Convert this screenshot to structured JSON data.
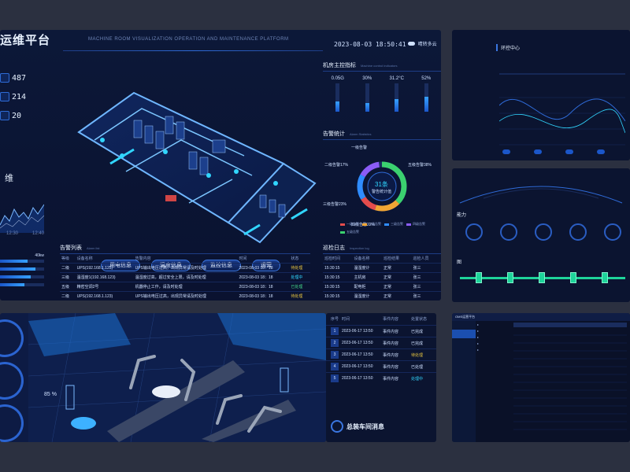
{
  "main": {
    "title": "运维平台",
    "subtitle": "MACHINE ROOM VISUALIZATION OPERATION AND MAINTENANCE PLATFORM",
    "datetime": "2023-08-03  18:50:41",
    "weather": "晴转多云",
    "left_stats": [
      {
        "value": "487",
        "icon": "server-icon"
      },
      {
        "value": "214",
        "icon": "cabinet-icon"
      },
      {
        "value": "20",
        "icon": "power-icon"
      }
    ],
    "left_ticks": [
      "12:30",
      "12:40"
    ],
    "dh_label": "维",
    "left_bars": [
      {
        "value": "40kw",
        "fill": 0.62
      },
      {
        "value": "",
        "fill": 0.8
      },
      {
        "value": "",
        "fill": 0.7
      },
      {
        "value": "",
        "fill": 0.55
      }
    ],
    "buttons": [
      "用电信息",
      "温度信息",
      "监控信息",
      "运营"
    ],
    "machine_indicators": {
      "title": "机房主控指标",
      "title_en": "Machine control indicators",
      "gauges": [
        {
          "value": "0.05G",
          "level": 0.35
        },
        {
          "value": "30%",
          "level": 0.3
        },
        {
          "value": "31.2°C",
          "level": 0.45
        },
        {
          "value": "52%",
          "level": 0.52
        }
      ]
    },
    "alarm_stats": {
      "title": "告警统计",
      "title_en": "Alarm Statistics",
      "center_value": "31条",
      "center_label": "警告统计值",
      "labels": [
        "一级告警",
        "二级告警17%",
        "三级告警23%",
        "四级告警22%",
        "五级告警38%"
      ],
      "legend": [
        {
          "label": "一级告警",
          "color": "#e44c4c"
        },
        {
          "label": "二级告警",
          "color": "#f0a534"
        },
        {
          "label": "三级告警",
          "color": "#2f8cff"
        },
        {
          "label": "四级告警",
          "color": "#8b5cf6"
        },
        {
          "label": "五级告警",
          "color": "#3bd16f"
        }
      ]
    },
    "alarm_list": {
      "title": "告警列表",
      "title_en": "Alarm list",
      "headers": [
        "等级",
        "设备名称",
        "告警内容",
        "时间",
        "状态"
      ],
      "rows": [
        [
          "二级",
          "UPS(192.168.1.123)",
          "UPS输出电压过高，出现异常请及时处理",
          "2023-08-03  18：18",
          "待处理"
        ],
        [
          "三级",
          "温湿度1(192.168.123)",
          "温湿度过高，超过安全上限，请及时处理",
          "2023-08-03  18：18",
          "处理中"
        ],
        [
          "五级",
          "精密空调2号",
          "机器停止工作，请及时处理",
          "2023-08-03  18：18",
          "已处理"
        ],
        [
          "二级",
          "UPS(192.168.1.123)",
          "UPS输出电压过高，出现异常请及时处理",
          "2023-08-03  18：18",
          "待处理"
        ]
      ]
    },
    "log": {
      "title": "巡检日志",
      "title_en": "Inspection log",
      "headers": [
        "巡检时间",
        "设备名称",
        "巡检结果",
        "巡检人员"
      ],
      "rows": [
        [
          "15:30:15",
          "温湿度计",
          "正常",
          "张三"
        ],
        [
          "15:30:15",
          "主机房",
          "正常",
          "张三"
        ],
        [
          "15:30:15",
          "配电柜",
          "正常",
          "张三"
        ],
        [
          "15:30:15",
          "温湿度计",
          "正常",
          "张三"
        ]
      ]
    }
  },
  "rtop": {
    "tab": "环控中心",
    "rows": [
      [
        "",
        "",
        "",
        "",
        "",
        ""
      ],
      [
        "",
        "",
        "",
        "",
        "",
        ""
      ]
    ]
  },
  "rmid": {
    "sections": [
      "能力",
      "图"
    ]
  },
  "bottom_left": {
    "pct": "85 %",
    "floor_title": ""
  },
  "events": {
    "headers": [
      "序号",
      "时间",
      "事件内容",
      "处置状态"
    ],
    "rows": [
      {
        "n": "1",
        "time": "2023-06-17 13:50",
        "event": "事件内容",
        "status": "已完成",
        "color": "#cfe0ff"
      },
      {
        "n": "2",
        "time": "2023-06-17 13:50",
        "event": "事件内容",
        "status": "已完成",
        "color": "#cfe0ff"
      },
      {
        "n": "3",
        "time": "2023-06-17 13:50",
        "event": "事件内容",
        "status": "待处理",
        "color": "#e6c43f"
      },
      {
        "n": "4",
        "time": "2023-06-17 13:50",
        "event": "事件内容",
        "status": "已处理",
        "color": "#cfe0ff"
      },
      {
        "n": "5",
        "time": "2023-06-17 13:50",
        "event": "事件内容",
        "status": "处理中",
        "color": "#31d6ff"
      }
    ],
    "title": "总装车间消息"
  },
  "br": {
    "top_title": "OMS运营平台",
    "top_items": [
      "",
      "",
      "",
      "",
      "",
      ""
    ],
    "side_items": [
      "",
      "",
      "",
      "",
      "",
      ""
    ],
    "tree": [
      "",
      "",
      "",
      "",
      "",
      "",
      "",
      "",
      "",
      ""
    ]
  },
  "colors": {
    "accent": "#31d6ff",
    "brand": "#2f6bd8",
    "ok": "#45d58a",
    "warn": "#e6c43f",
    "danger": "#ff5f5f"
  }
}
